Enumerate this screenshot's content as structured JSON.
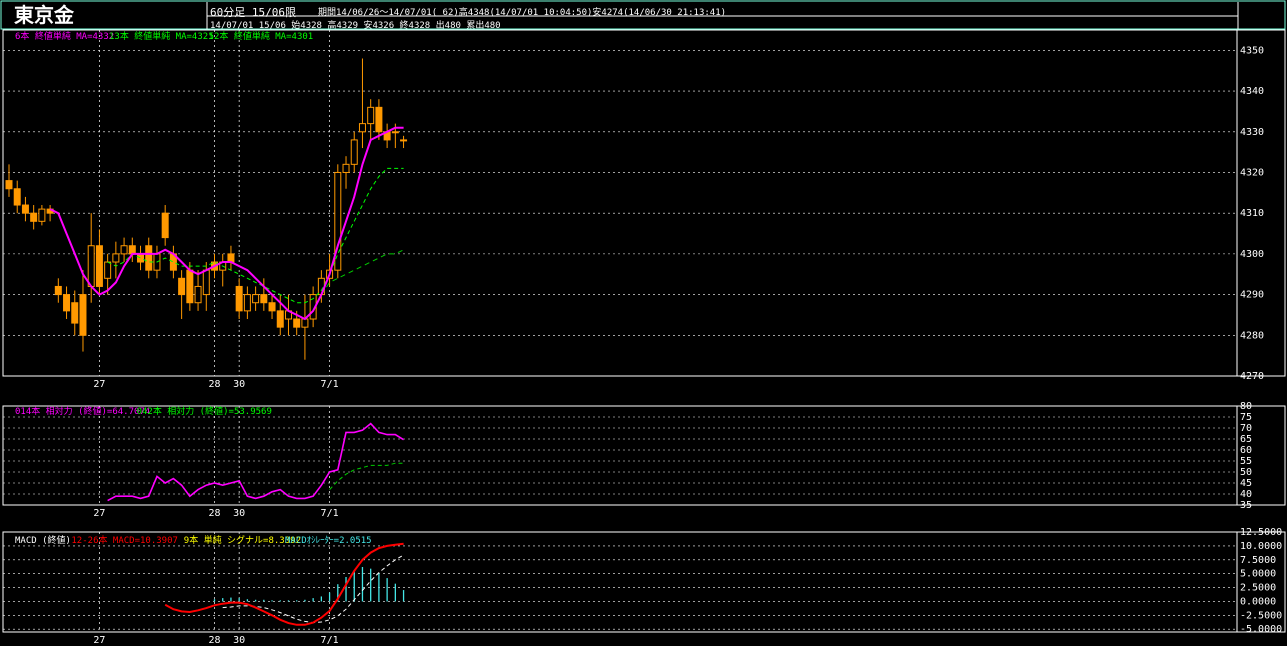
{
  "header": {
    "title": "東京金",
    "period_label": "60分足 15/06限",
    "period_info": "期間14/06/26〜14/07/01( 62)高4348(14/07/01 10:04:50)安4274(14/06/30 21:13:41)",
    "last_bar": "14/07/01 15/06 始4328 高4329 安4326 終4328 出480 累出480"
  },
  "colors": {
    "background": "#000000",
    "frame": "#ffffff",
    "grid": "#ffffff",
    "candle_up": "#000000",
    "candle_down": "#ff9900",
    "candle_outline": "#ff9900",
    "ma_short": "#ff00ff",
    "ma_mid": "#00ff00",
    "ma_long": "#00cc00",
    "rsi14": "#ff00ff",
    "rsi42": "#00cc00",
    "macd": "#ff0000",
    "signal": "#ffffff",
    "osc": "#44e6e6"
  },
  "legends": {
    "price": [
      {
        "text": "6本 終値単純 MA=4332",
        "color": "#ff00ff"
      },
      {
        "text": "13本 終値単純 MA=4321",
        "color": "#00ff00"
      },
      {
        "text": "52本 終値単純 MA=4301",
        "color": "#00ff00"
      }
    ],
    "rsi": [
      {
        "text": "014本 相対力 (終値)=64.7074",
        "color": "#ff00ff"
      },
      {
        "text": "042本 相対力 (終値)=53.9569",
        "color": "#00ff00"
      }
    ],
    "macd": [
      {
        "text": "MACD (終値)",
        "color": "#ffffff"
      },
      {
        "text": "12-26本 MACD=10.3907",
        "color": "#ff0000"
      },
      {
        "text": "9本 単純 シグナル=8.3392",
        "color": "#ffff00"
      },
      {
        "text": "MACDｵｼﾚｰﾀｰ=2.0515",
        "color": "#44e6e6"
      }
    ]
  },
  "chart_data": [
    {
      "type": "candlestick",
      "title": "東京金 60分足 15/06限",
      "ylim": [
        4270,
        4355
      ],
      "y_ticks": [
        "4350",
        "4340",
        "4330",
        "4320",
        "4310",
        "4300",
        "4290",
        "4280",
        "4270"
      ],
      "x_tick_labels": [
        {
          "label": "27",
          "index": 11
        },
        {
          "label": "28",
          "index": 25
        },
        {
          "label": "30",
          "index": 28
        },
        {
          "label": "7/1",
          "index": 39
        }
      ],
      "candles": [
        [
          4318,
          4322,
          4314,
          4316
        ],
        [
          4316,
          4318,
          4310,
          4312
        ],
        [
          4312,
          4314,
          4308,
          4310
        ],
        [
          4310,
          4312,
          4306,
          4308
        ],
        [
          4308,
          4312,
          4307,
          4311
        ],
        [
          4311,
          4312,
          4308,
          4310
        ],
        [
          4292,
          4294,
          4288,
          4290
        ],
        [
          4290,
          4292,
          4284,
          4286
        ],
        [
          4288,
          4291,
          4280,
          4283
        ],
        [
          4290,
          4296,
          4276,
          4280
        ],
        [
          4292,
          4310,
          4288,
          4302
        ],
        [
          4302,
          4306,
          4290,
          4292
        ],
        [
          4294,
          4300,
          4290,
          4298
        ],
        [
          4298,
          4303,
          4294,
          4300
        ],
        [
          4300,
          4304,
          4298,
          4302
        ],
        [
          4302,
          4304,
          4298,
          4300
        ],
        [
          4300,
          4302,
          4296,
          4298
        ],
        [
          4302,
          4304,
          4294,
          4296
        ],
        [
          4296,
          4302,
          4294,
          4300
        ],
        [
          4310,
          4312,
          4302,
          4304
        ],
        [
          4300,
          4302,
          4294,
          4296
        ],
        [
          4294,
          4296,
          4284,
          4290
        ],
        [
          4296,
          4298,
          4286,
          4288
        ],
        [
          4288,
          4296,
          4286,
          4292
        ],
        [
          4290,
          4298,
          4286,
          4296
        ],
        [
          4298,
          4300,
          4294,
          4296
        ],
        [
          4296,
          4300,
          4292,
          4298
        ],
        [
          4300,
          4302,
          4296,
          4298
        ],
        [
          4292,
          4294,
          4284,
          4286
        ],
        [
          4286,
          4292,
          4284,
          4290
        ],
        [
          4288,
          4292,
          4286,
          4290
        ],
        [
          4290,
          4294,
          4286,
          4288
        ],
        [
          4288,
          4290,
          4284,
          4286
        ],
        [
          4286,
          4290,
          4280,
          4282
        ],
        [
          4284,
          4290,
          4280,
          4286
        ],
        [
          4284,
          4286,
          4280,
          4282
        ],
        [
          4282,
          4290,
          4274,
          4284
        ],
        [
          4284,
          4292,
          4282,
          4290
        ],
        [
          4290,
          4296,
          4288,
          4294
        ],
        [
          4294,
          4300,
          4292,
          4296
        ],
        [
          4296,
          4322,
          4294,
          4320
        ],
        [
          4320,
          4324,
          4316,
          4322
        ],
        [
          4322,
          4330,
          4320,
          4328
        ],
        [
          4330,
          4348,
          4326,
          4332
        ],
        [
          4332,
          4338,
          4328,
          4336
        ],
        [
          4336,
          4338,
          4328,
          4330
        ],
        [
          4330,
          4332,
          4326,
          4328
        ],
        [
          4330,
          4332,
          4326,
          4330
        ],
        [
          4328,
          4329,
          4326,
          4328
        ]
      ],
      "series": [
        {
          "name": "6本 終値単純 MA",
          "values": [
            null,
            null,
            null,
            null,
            null,
            4311,
            4310,
            4305,
            4300,
            4295,
            4292,
            4290,
            4291,
            4293,
            4297,
            4300,
            4300,
            4300,
            4300,
            4301,
            4300,
            4298,
            4296,
            4295,
            4296,
            4297,
            4298,
            4298,
            4297,
            4296,
            4294,
            4292,
            4290,
            4288,
            4286,
            4285,
            4284,
            4286,
            4290,
            4295,
            4302,
            4308,
            4314,
            4322,
            4328,
            4329,
            4330,
            4331,
            4331
          ]
        },
        {
          "name": "13本 終値単純 MA",
          "values": [
            null,
            null,
            null,
            null,
            null,
            null,
            null,
            null,
            null,
            null,
            null,
            null,
            4298,
            4297,
            4298,
            4300,
            4299,
            4298,
            4298,
            4299,
            4298,
            4297,
            4297,
            4297,
            4297,
            4298,
            4297,
            4296,
            4295,
            4294,
            4293,
            4292,
            4291,
            4290,
            4289,
            4288,
            4288,
            4289,
            4291,
            4295,
            4300,
            4304,
            4308,
            4312,
            4316,
            4319,
            4321,
            4321,
            4321
          ]
        },
        {
          "name": "52本 終値単純 MA",
          "values": [
            null,
            null,
            null,
            null,
            null,
            null,
            null,
            null,
            null,
            null,
            null,
            null,
            null,
            null,
            null,
            null,
            null,
            null,
            null,
            null,
            null,
            null,
            null,
            null,
            null,
            null,
            null,
            null,
            null,
            null,
            null,
            null,
            null,
            null,
            null,
            null,
            null,
            null,
            4290,
            4293,
            4294,
            4295,
            4296,
            4297,
            4298,
            4299,
            4300,
            4300,
            4301
          ]
        }
      ]
    },
    {
      "type": "line",
      "title": "相対力指数",
      "ylim": [
        35,
        80
      ],
      "y_ticks": [
        "80",
        "75",
        "70",
        "65",
        "60",
        "55",
        "50",
        "45",
        "40",
        "35"
      ],
      "series": [
        {
          "name": "014本 相対力 (終値)",
          "values": [
            null,
            null,
            null,
            null,
            null,
            null,
            null,
            null,
            null,
            null,
            null,
            null,
            37,
            39,
            39,
            39,
            38,
            39,
            48,
            45,
            47,
            44,
            39,
            42,
            44,
            45,
            44,
            45,
            46,
            39,
            38,
            39,
            41,
            42,
            39,
            38,
            38,
            39,
            44,
            50,
            51,
            68,
            68,
            69,
            72,
            68,
            67,
            67,
            64.7
          ]
        },
        {
          "name": "042本 相対力 (終値)",
          "values": [
            null,
            null,
            null,
            null,
            null,
            null,
            null,
            null,
            null,
            null,
            null,
            null,
            null,
            null,
            null,
            null,
            null,
            null,
            null,
            null,
            null,
            null,
            null,
            null,
            null,
            null,
            null,
            null,
            null,
            null,
            null,
            null,
            null,
            null,
            null,
            null,
            null,
            null,
            null,
            42,
            46,
            49,
            51,
            52,
            53,
            53,
            53,
            54,
            54
          ]
        }
      ]
    },
    {
      "type": "line",
      "title": "MACD (終値)",
      "ylim": [
        -5.5,
        12.5
      ],
      "y_ticks": [
        "12.5000",
        "10.0000",
        "7.5000",
        "5.0000",
        "2.5000",
        "0.0000",
        "-2.5000",
        "-5.0000"
      ],
      "series": [
        {
          "name": "12-26本 MACD",
          "values": [
            null,
            null,
            null,
            null,
            null,
            null,
            null,
            null,
            null,
            null,
            null,
            null,
            null,
            null,
            null,
            null,
            null,
            null,
            null,
            -0.6,
            -1.4,
            -1.8,
            -1.9,
            -1.6,
            -1.2,
            -0.7,
            -0.4,
            -0.2,
            -0.2,
            -0.5,
            -1.1,
            -1.8,
            -2.5,
            -3.3,
            -3.9,
            -4.2,
            -4.2,
            -3.8,
            -2.9,
            -1.7,
            0.5,
            3.0,
            5.5,
            7.5,
            8.8,
            9.6,
            10.0,
            10.2,
            10.39
          ]
        },
        {
          "name": "9本 単純 シグナル",
          "values": [
            null,
            null,
            null,
            null,
            null,
            null,
            null,
            null,
            null,
            null,
            null,
            null,
            null,
            null,
            null,
            null,
            null,
            null,
            null,
            null,
            null,
            null,
            null,
            null,
            null,
            null,
            -1.1,
            -1.0,
            -0.8,
            -0.8,
            -0.9,
            -1.1,
            -1.5,
            -2.0,
            -2.6,
            -3.2,
            -3.6,
            -3.8,
            -3.7,
            -3.3,
            -2.6,
            -1.4,
            0.3,
            2.0,
            3.7,
            5.2,
            6.4,
            7.5,
            8.34
          ]
        },
        {
          "name": "MACDｵｼﾚｰﾀｰ",
          "values": [
            null,
            null,
            null,
            null,
            null,
            null,
            null,
            null,
            null,
            null,
            null,
            null,
            null,
            null,
            null,
            null,
            null,
            null,
            null,
            null,
            null,
            null,
            null,
            null,
            null,
            0.4,
            0.6,
            0.7,
            0.6,
            0.4,
            0.3,
            0.3,
            0.2,
            0.2,
            0.2,
            0.2,
            0.3,
            0.6,
            0.9,
            1.6,
            3.1,
            4.4,
            5.6,
            6.2,
            5.9,
            5.1,
            4.2,
            3.2,
            2.05
          ]
        }
      ]
    }
  ]
}
